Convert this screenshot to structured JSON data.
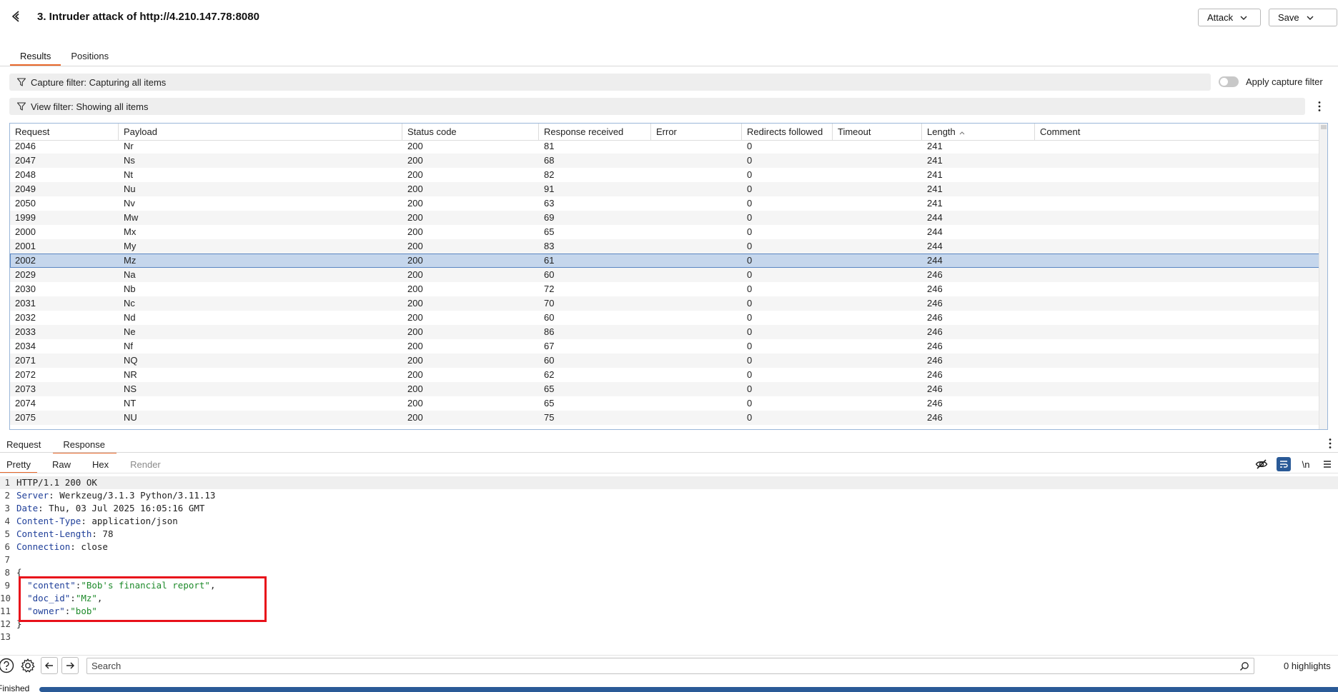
{
  "header": {
    "title": "3. Intruder attack of http://4.210.147.78:8080",
    "attack_label": "Attack",
    "save_label": "Save"
  },
  "tabs": [
    {
      "label": "Results",
      "active": true
    },
    {
      "label": "Positions",
      "active": false
    }
  ],
  "filters": {
    "capture": "Capture filter: Capturing all items",
    "view": "View filter: Showing all items",
    "apply_capture_label": "Apply capture filter",
    "apply_capture_on": false
  },
  "table": {
    "columns": [
      "Request",
      "Payload",
      "Status code",
      "Response received",
      "Error",
      "Redirects followed",
      "Timeout",
      "Length",
      "Comment"
    ],
    "sort_column": "Length",
    "sort_direction": "ascending",
    "rows": [
      {
        "request": "2046",
        "payload": "Nr",
        "status": "200",
        "received": "81",
        "error": "",
        "redirects": "0",
        "timeout": "",
        "length": "241",
        "comment": ""
      },
      {
        "request": "2047",
        "payload": "Ns",
        "status": "200",
        "received": "68",
        "error": "",
        "redirects": "0",
        "timeout": "",
        "length": "241",
        "comment": ""
      },
      {
        "request": "2048",
        "payload": "Nt",
        "status": "200",
        "received": "82",
        "error": "",
        "redirects": "0",
        "timeout": "",
        "length": "241",
        "comment": ""
      },
      {
        "request": "2049",
        "payload": "Nu",
        "status": "200",
        "received": "91",
        "error": "",
        "redirects": "0",
        "timeout": "",
        "length": "241",
        "comment": ""
      },
      {
        "request": "2050",
        "payload": "Nv",
        "status": "200",
        "received": "63",
        "error": "",
        "redirects": "0",
        "timeout": "",
        "length": "241",
        "comment": ""
      },
      {
        "request": "1999",
        "payload": "Mw",
        "status": "200",
        "received": "69",
        "error": "",
        "redirects": "0",
        "timeout": "",
        "length": "244",
        "comment": ""
      },
      {
        "request": "2000",
        "payload": "Mx",
        "status": "200",
        "received": "65",
        "error": "",
        "redirects": "0",
        "timeout": "",
        "length": "244",
        "comment": ""
      },
      {
        "request": "2001",
        "payload": "My",
        "status": "200",
        "received": "83",
        "error": "",
        "redirects": "0",
        "timeout": "",
        "length": "244",
        "comment": ""
      },
      {
        "request": "2002",
        "payload": "Mz",
        "status": "200",
        "received": "61",
        "error": "",
        "redirects": "0",
        "timeout": "",
        "length": "244",
        "comment": "",
        "selected": true
      },
      {
        "request": "2029",
        "payload": "Na",
        "status": "200",
        "received": "60",
        "error": "",
        "redirects": "0",
        "timeout": "",
        "length": "246",
        "comment": ""
      },
      {
        "request": "2030",
        "payload": "Nb",
        "status": "200",
        "received": "72",
        "error": "",
        "redirects": "0",
        "timeout": "",
        "length": "246",
        "comment": ""
      },
      {
        "request": "2031",
        "payload": "Nc",
        "status": "200",
        "received": "70",
        "error": "",
        "redirects": "0",
        "timeout": "",
        "length": "246",
        "comment": ""
      },
      {
        "request": "2032",
        "payload": "Nd",
        "status": "200",
        "received": "60",
        "error": "",
        "redirects": "0",
        "timeout": "",
        "length": "246",
        "comment": ""
      },
      {
        "request": "2033",
        "payload": "Ne",
        "status": "200",
        "received": "86",
        "error": "",
        "redirects": "0",
        "timeout": "",
        "length": "246",
        "comment": ""
      },
      {
        "request": "2034",
        "payload": "Nf",
        "status": "200",
        "received": "67",
        "error": "",
        "redirects": "0",
        "timeout": "",
        "length": "246",
        "comment": ""
      },
      {
        "request": "2071",
        "payload": "NQ",
        "status": "200",
        "received": "60",
        "error": "",
        "redirects": "0",
        "timeout": "",
        "length": "246",
        "comment": ""
      },
      {
        "request": "2072",
        "payload": "NR",
        "status": "200",
        "received": "62",
        "error": "",
        "redirects": "0",
        "timeout": "",
        "length": "246",
        "comment": ""
      },
      {
        "request": "2073",
        "payload": "NS",
        "status": "200",
        "received": "65",
        "error": "",
        "redirects": "0",
        "timeout": "",
        "length": "246",
        "comment": ""
      },
      {
        "request": "2074",
        "payload": "NT",
        "status": "200",
        "received": "65",
        "error": "",
        "redirects": "0",
        "timeout": "",
        "length": "246",
        "comment": ""
      },
      {
        "request": "2075",
        "payload": "NU",
        "status": "200",
        "received": "75",
        "error": "",
        "redirects": "0",
        "timeout": "",
        "length": "246",
        "comment": ""
      }
    ]
  },
  "pane_tabs": [
    {
      "label": "Request",
      "active": false
    },
    {
      "label": "Response",
      "active": true
    }
  ],
  "view_tabs": [
    {
      "label": "Pretty",
      "active": true,
      "disabled": false
    },
    {
      "label": "Raw",
      "active": false,
      "disabled": false
    },
    {
      "label": "Hex",
      "active": false,
      "disabled": false
    },
    {
      "label": "Render",
      "active": false,
      "disabled": true
    }
  ],
  "toolbar_icons": {
    "newline_label": "\\n"
  },
  "response": {
    "status_line": "HTTP/1.1 200 OK",
    "headers": [
      {
        "name": "Server",
        "value": "Werkzeug/3.1.3 Python/3.11.13"
      },
      {
        "name": "Date",
        "value": "Thu, 03 Jul 2025 16:05:16 GMT"
      },
      {
        "name": "Content-Type",
        "value": "application/json"
      },
      {
        "name": "Content-Length",
        "value": "78"
      },
      {
        "name": "Connection",
        "value": "close"
      }
    ],
    "body_open": "{",
    "body_fields": [
      {
        "key": "\"content\"",
        "value": "\"Bob's financial report\"",
        "trail": ","
      },
      {
        "key": "\"doc_id\"",
        "value": "\"Mz\"",
        "trail": ","
      },
      {
        "key": "\"owner\"",
        "value": "\"bob\"",
        "trail": ""
      }
    ],
    "body_close": "}",
    "line_numbers": [
      "1",
      "2",
      "3",
      "4",
      "5",
      "6",
      "7",
      "8",
      "9",
      "10",
      "11",
      "12",
      "13"
    ]
  },
  "footer": {
    "search_placeholder": "Search",
    "highlights": "0 highlights",
    "status": "Finished",
    "progress_fraction": 1.0
  },
  "colors": {
    "accent": "#e8672a",
    "selection": "#c5d6ec",
    "progress": "#2a5a97",
    "highlight_box": "#e8111a",
    "json_value": "#1d8a2a",
    "json_key": "#1f3f99"
  }
}
